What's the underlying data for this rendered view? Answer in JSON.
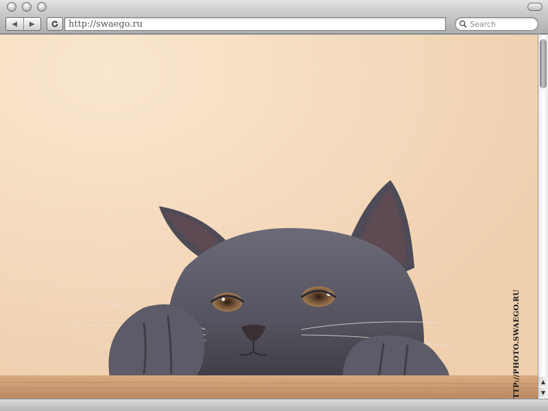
{
  "browser": {
    "nav": {
      "back_icon": "◀",
      "forward_icon": "▶",
      "reload_icon": "reload-icon"
    },
    "address": {
      "value": "http://swaego.ru"
    },
    "search": {
      "placeholder": "Search"
    }
  },
  "page": {
    "photo": "gray cat peeking over a wooden table edge",
    "watermark": "HTTP://PHOTO.SWAEGO.RU"
  },
  "scrollbar": {
    "up_icon": "▲",
    "down_icon": "▼"
  },
  "colors": {
    "background_peach": "#f4d5b7",
    "cat_gray": "#5b5a66",
    "table_wood": "#c89a6f",
    "watermark": "#1a1a1a"
  }
}
